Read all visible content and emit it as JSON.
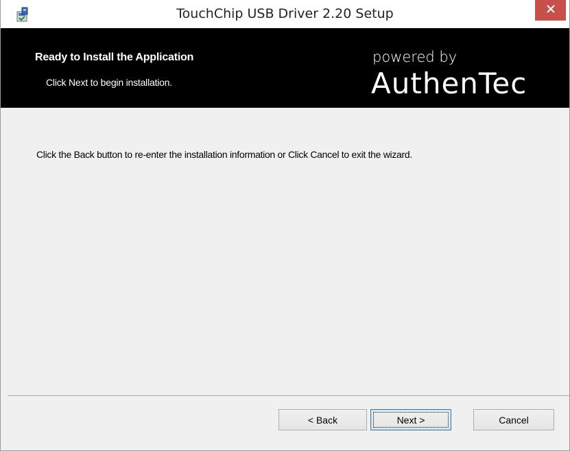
{
  "window": {
    "title": "TouchChip USB Driver 2.20 Setup",
    "app_icon": "installer-icon",
    "close_icon": "close-icon"
  },
  "header": {
    "title": "Ready to Install the Application",
    "subtitle": "Click Next to begin installation.",
    "brand_tagline": "powered by",
    "brand_name": "AuthenTec"
  },
  "content": {
    "body_text": "Click the Back button to re-enter the installation information or Click Cancel to exit the wizard."
  },
  "buttons": {
    "back_label": "< Back",
    "next_label": "Next >",
    "cancel_label": "Cancel"
  },
  "colors": {
    "banner_bg": "#000000",
    "banner_text": "#ffffff",
    "close_button": "#c7504a",
    "dialog_bg": "#f0f0f0"
  }
}
